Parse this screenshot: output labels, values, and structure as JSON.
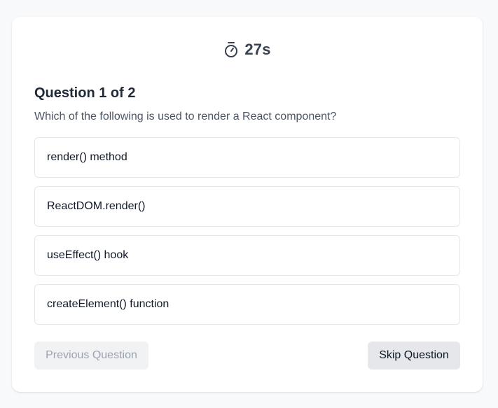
{
  "timer": {
    "icon": "stopwatch-icon",
    "value": "27s"
  },
  "question": {
    "title": "Question 1 of 2",
    "text": "Which of the following is used to render a React component?"
  },
  "options": [
    {
      "label": "render() method"
    },
    {
      "label": "ReactDOM.render()"
    },
    {
      "label": "useEffect() hook"
    },
    {
      "label": "createElement() function"
    }
  ],
  "buttons": {
    "previous_label": "Previous Question",
    "skip_label": "Skip Question"
  }
}
